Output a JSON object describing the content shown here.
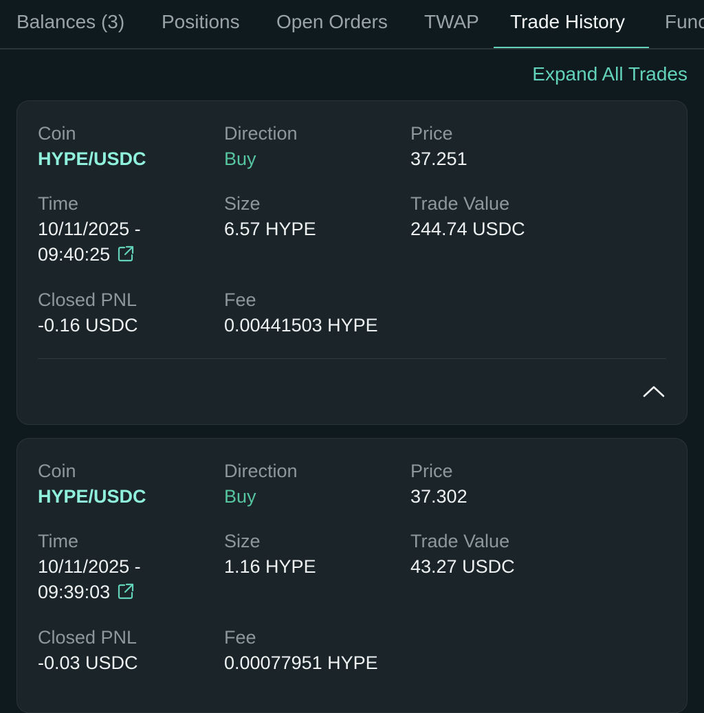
{
  "tabs": [
    {
      "label": "Balances (3)"
    },
    {
      "label": "Positions"
    },
    {
      "label": "Open Orders"
    },
    {
      "label": "TWAP"
    },
    {
      "label": "Trade History"
    },
    {
      "label": "Func"
    }
  ],
  "active_tab": "Trade History",
  "expand_label": "Expand All Trades",
  "labels": {
    "coin": "Coin",
    "direction": "Direction",
    "price": "Price",
    "time": "Time",
    "size": "Size",
    "trade_value": "Trade Value",
    "closed_pnl": "Closed PNL",
    "fee": "Fee"
  },
  "trades": [
    {
      "coin": "HYPE/USDC",
      "direction": "Buy",
      "price": "37.251",
      "time_date": "10/11/2025 -",
      "time_clock": "09:40:25",
      "size": "6.57 HYPE",
      "trade_value": "244.74 USDC",
      "closed_pnl": "-0.16 USDC",
      "fee": "0.00441503 HYPE"
    },
    {
      "coin": "HYPE/USDC",
      "direction": "Buy",
      "price": "37.302",
      "time_date": "10/11/2025 -",
      "time_clock": "09:39:03",
      "size": "1.16 HYPE",
      "trade_value": "43.27 USDC",
      "closed_pnl": "-0.03 USDC",
      "fee": "0.00077951 HYPE"
    }
  ],
  "icons": {
    "external_link": "external-link-icon",
    "collapse": "chevron-up-icon"
  },
  "colors": {
    "accent": "#62d2ba",
    "coin": "#8ff0dc",
    "buy": "#56c5a0",
    "background": "#0f1a1f",
    "card": "#1b2429"
  }
}
